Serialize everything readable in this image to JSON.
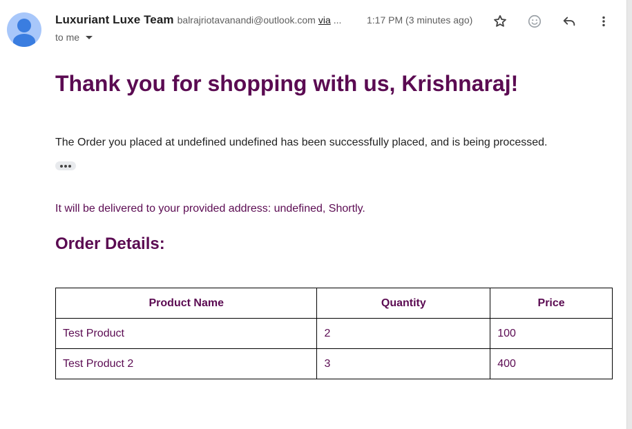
{
  "header": {
    "sender_name": "Luxuriant Luxe Team",
    "sender_email": "balrajriotavanandi@outlook.com",
    "via_label": "via",
    "ellipsis": "...",
    "timestamp": "1:17 PM (3 minutes ago)",
    "recipient_label": "to me",
    "icons": [
      "star-icon",
      "emoji-icon",
      "reply-icon",
      "more-vert-icon"
    ]
  },
  "email_body": {
    "greeting": "Thank you for shopping with us, Krishnaraj!",
    "order_message": "The Order you placed at undefined undefined has been successfully placed, and is being processed.",
    "delivery_message": "It will be delivered to your provided address: undefined, Shortly.",
    "order_details_heading": "Order Details:",
    "table": {
      "headers": [
        "Product Name",
        "Quantity",
        "Price"
      ],
      "rows": [
        [
          "Test Product",
          "2",
          "100"
        ],
        [
          "Test Product 2",
          "3",
          "400"
        ]
      ]
    }
  },
  "colors": {
    "accent_purple": "#5b0b52",
    "avatar_light": "#a8c7fa",
    "avatar_dark": "#3a7de0",
    "meta_gray": "#5e5e5e"
  }
}
